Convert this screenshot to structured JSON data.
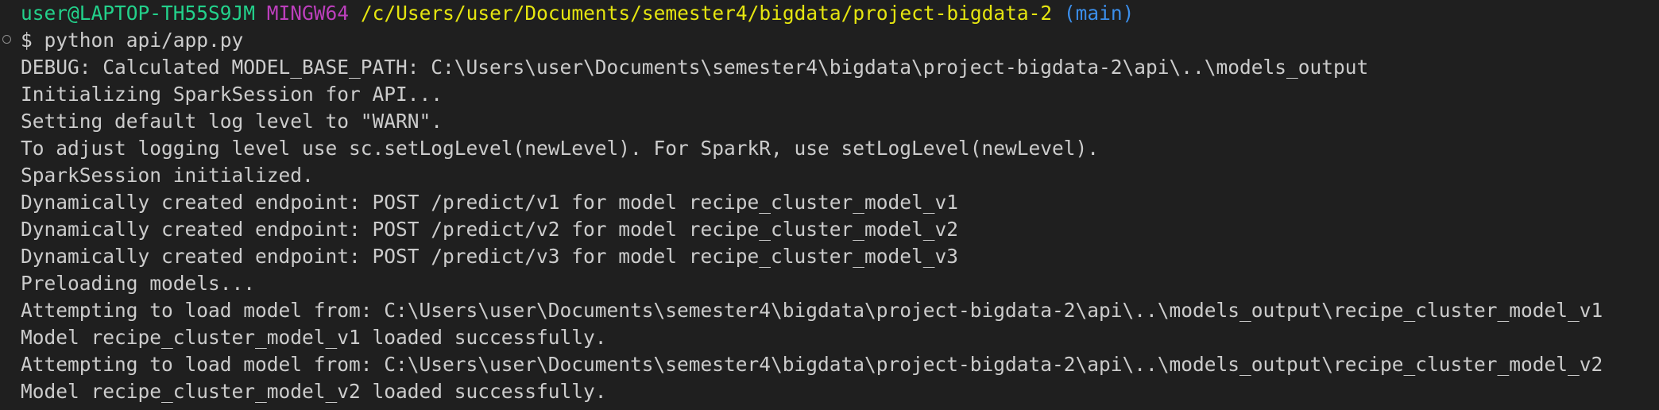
{
  "prompt": {
    "user_host": "user@LAPTOP-TH55S9JM",
    "shell": "MINGW64",
    "cwd": "/c/Users/user/Documents/semester4/bigdata/project-bigdata-2",
    "branch": "(main)"
  },
  "command": "$ python api/app.py",
  "output_lines": [
    "DEBUG: Calculated MODEL_BASE_PATH: C:\\Users\\user\\Documents\\semester4\\bigdata\\project-bigdata-2\\api\\..\\models_output",
    "Initializing SparkSession for API...",
    "Setting default log level to \"WARN\".",
    "To adjust logging level use sc.setLogLevel(newLevel). For SparkR, use setLogLevel(newLevel).",
    "SparkSession initialized.",
    "Dynamically created endpoint: POST /predict/v1 for model recipe_cluster_model_v1",
    "Dynamically created endpoint: POST /predict/v2 for model recipe_cluster_model_v2",
    "Dynamically created endpoint: POST /predict/v3 for model recipe_cluster_model_v3",
    "Preloading models...",
    "Attempting to load model from: C:\\Users\\user\\Documents\\semester4\\bigdata\\project-bigdata-2\\api\\..\\models_output\\recipe_cluster_model_v1",
    "Model recipe_cluster_model_v1 loaded successfully.",
    "Attempting to load model from: C:\\Users\\user\\Documents\\semester4\\bigdata\\project-bigdata-2\\api\\..\\models_output\\recipe_cluster_model_v2",
    "Model recipe_cluster_model_v2 loaded successfully."
  ],
  "colors": {
    "background": "#1f1f1f",
    "text": "#cccccc",
    "user_host": "#23d18b",
    "shell": "#bc3fbc",
    "cwd": "#e5e510",
    "branch": "#3b8eea"
  }
}
